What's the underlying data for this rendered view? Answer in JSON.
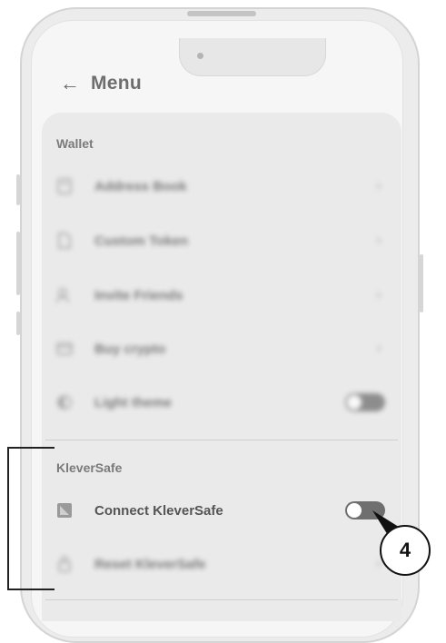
{
  "header": {
    "back_icon": "arrow-left-icon",
    "title": "Menu"
  },
  "wallet": {
    "section_label": "Wallet",
    "items": [
      {
        "label": "Address Book",
        "icon": "book-icon",
        "control": "chevron"
      },
      {
        "label": "Custom Token",
        "icon": "document-icon",
        "control": "chevron"
      },
      {
        "label": "Invite Friends",
        "icon": "person-add-icon",
        "control": "chevron"
      },
      {
        "label": "Buy crypto",
        "icon": "card-icon",
        "control": "chevron"
      },
      {
        "label": "Light theme",
        "icon": "theme-icon",
        "control": "toggle",
        "toggle_on": false
      }
    ]
  },
  "kleversafe": {
    "section_label": "KleverSafe",
    "connect": {
      "label": "Connect KleverSafe",
      "icon": "kleversafe-icon",
      "toggle_on": false
    },
    "reset": {
      "label": "Reset KleverSafe",
      "icon": "lock-icon",
      "control": "chevron"
    }
  },
  "annotation": {
    "step_number": "4"
  },
  "colors": {
    "screen_bg": "#f6f6f6",
    "card_bg": "#eaeaea",
    "toggle_track": "#6f6f6f",
    "annotation": "#111111"
  }
}
